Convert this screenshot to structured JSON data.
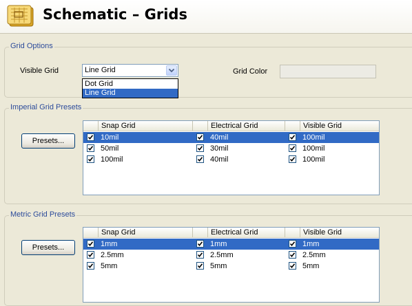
{
  "header": {
    "title": "Schematic – Grids"
  },
  "grid_options": {
    "group_label": "Grid Options",
    "visible_grid_label": "Visible Grid",
    "visible_grid_value": "Line Grid",
    "dropdown_options": [
      "Dot Grid",
      "Line Grid"
    ],
    "dropdown_selected": "Line Grid",
    "grid_color_label": "Grid Color"
  },
  "imperial": {
    "group_label": "Imperial Grid Presets",
    "presets_button": "Presets...",
    "columns": [
      "Snap Grid",
      "Electrical Grid",
      "Visible Grid"
    ],
    "rows": [
      {
        "snap": "10mil",
        "electrical": "40mil",
        "visible": "100mil",
        "selected": true
      },
      {
        "snap": "50mil",
        "electrical": "30mil",
        "visible": "100mil",
        "selected": false
      },
      {
        "snap": "100mil",
        "electrical": "40mil",
        "visible": "100mil",
        "selected": false
      }
    ]
  },
  "metric": {
    "group_label": "Metric Grid Presets",
    "presets_button": "Presets...",
    "columns": [
      "Snap Grid",
      "Electrical Grid",
      "Visible Grid"
    ],
    "rows": [
      {
        "snap": "1mm",
        "electrical": "1mm",
        "visible": "1mm",
        "selected": true
      },
      {
        "snap": "2.5mm",
        "electrical": "2.5mm",
        "visible": "2.5mm",
        "selected": false
      },
      {
        "snap": "5mm",
        "electrical": "5mm",
        "visible": "5mm",
        "selected": false
      }
    ]
  },
  "icons": {
    "app": "schematic-grid-icon",
    "dropdown": "chevron-down-icon",
    "checkbox": "checkmark-icon"
  },
  "colors": {
    "accent": "#2b4a9a",
    "selection": "#316ac5",
    "background": "#ece9d8"
  }
}
